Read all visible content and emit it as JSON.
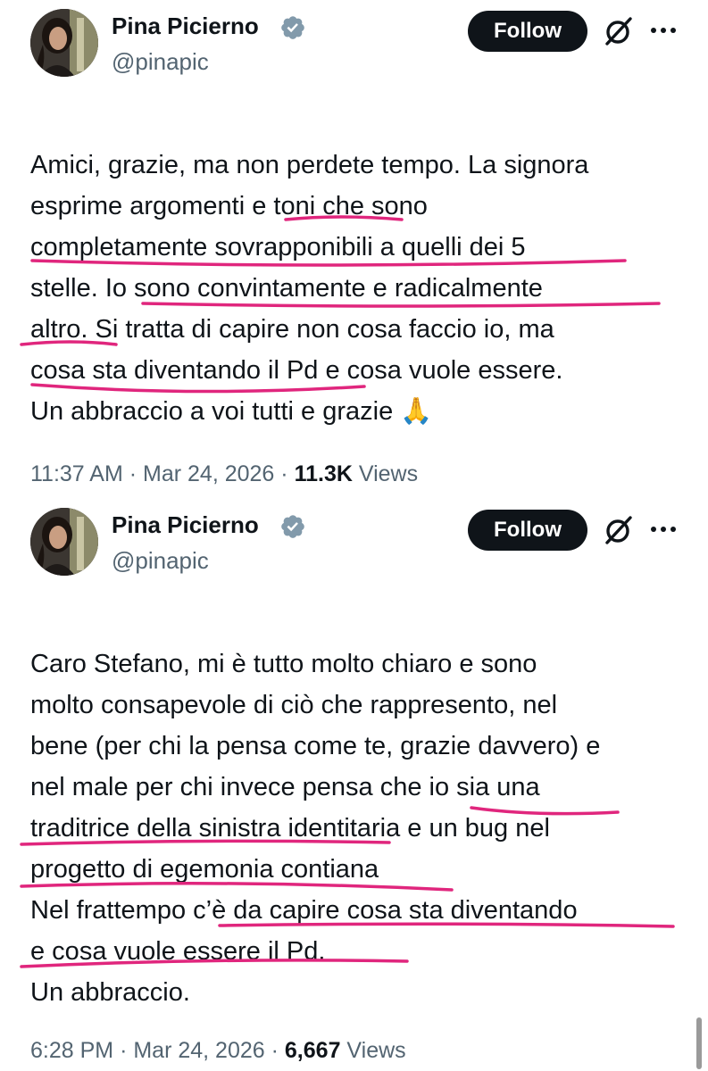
{
  "colors": {
    "accent": "#0f1419",
    "verified": "#829aab",
    "muted": "#536471",
    "highlight_marker": "#e0267d"
  },
  "tweets": [
    {
      "author": {
        "name": "Pina Picierno",
        "handle": "@pinapic"
      },
      "follow_label": "Follow",
      "lines": [
        "Amici, grazie, ma non perdete tempo. La signora",
        "esprime argomenti e toni che sono",
        "completamente sovrapponibili a quelli dei 5",
        "stelle. Io sono convintamente  e radicalmente",
        "altro.  Si tratta di capire non cosa faccio io, ma",
        "cosa sta diventando il Pd e cosa vuole essere.",
        "Un abbraccio a voi tutti e grazie 🙏"
      ],
      "time": "11:37 AM",
      "date": "Mar 24, 2026",
      "views_count": "11.3K",
      "views_label": "Views",
      "separator": "·"
    },
    {
      "author": {
        "name": "Pina Picierno",
        "handle": "@pinapic"
      },
      "follow_label": "Follow",
      "lines": [
        "Caro Stefano, mi è tutto molto chiaro e sono",
        "molto consapevole di ciò che rappresento, nel",
        "bene (per chi la pensa come te, grazie davvero) e",
        "nel male per chi invece pensa che io sia una",
        "traditrice della sinistra identitaria e un bug nel",
        "progetto di egemonia contiana",
        "Nel frattempo c’è da capire cosa sta diventando",
        "e cosa vuole essere il Pd.",
        "Un abbraccio."
      ],
      "time": "6:28 PM",
      "date": "Mar 24, 2026",
      "views_count": "6,667",
      "views_label": "Views",
      "separator": "·"
    }
  ],
  "icons": {
    "avatar": "avatar-photo",
    "verified": "verified-badge-icon",
    "grok": "grok-icon",
    "more": "more-options-icon"
  }
}
